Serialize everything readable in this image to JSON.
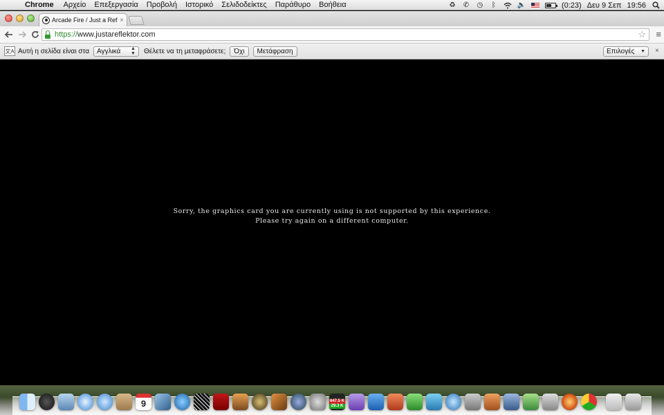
{
  "menubar": {
    "app_name": "Chrome",
    "items": [
      "Αρχείο",
      "Επεξεργασία",
      "Προβολή",
      "Ιστορικό",
      "Σελιδοδείκτες",
      "Παράθυρο",
      "Βοήθεια"
    ],
    "battery_text": "(0:23)",
    "date": "Δευ 9 Σεπ",
    "time": "19:56"
  },
  "browser": {
    "tab_title": "Arcade Fire / Just a Reflektor",
    "url_scheme": "https://",
    "url_rest": "www.justareflektor.com"
  },
  "translate_bar": {
    "prompt": "Αυτή η σελίδα είναι στα",
    "language": "Αγγλικά",
    "question": "Θέλετε να τη μεταφράσετε;",
    "no_button": "Όχι",
    "translate_button": "Μετάφραση",
    "options_button": "Επιλογές"
  },
  "page": {
    "message_line1": "Sorry, the graphics card you are currently using is not supported by this experience.",
    "message_line2": "Please try again on a different computer."
  },
  "dock": {
    "calendar_day": "9",
    "network_up": "647.5 K",
    "network_down": "29.3 K",
    "icons": [
      "finder",
      "dashboard",
      "mail",
      "safari",
      "facetime",
      "address-book",
      "ical",
      "iphoto",
      "itunes",
      "grid-app",
      "photobooth",
      "preview",
      "imovie",
      "garageband",
      "time-machine",
      "system-preferences",
      "network-monitor",
      "purple-app",
      "word",
      "powerpoint",
      "excel",
      "messenger",
      "itunes-globe",
      "migration",
      "keynote",
      "pen-app",
      "numbers",
      "apps",
      "firefox",
      "chrome",
      "finder-window",
      "trash"
    ]
  },
  "colors": {
    "secure_green": "#2e9b2e",
    "content_bg": "#000000",
    "message_text": "#e8e8e8"
  }
}
